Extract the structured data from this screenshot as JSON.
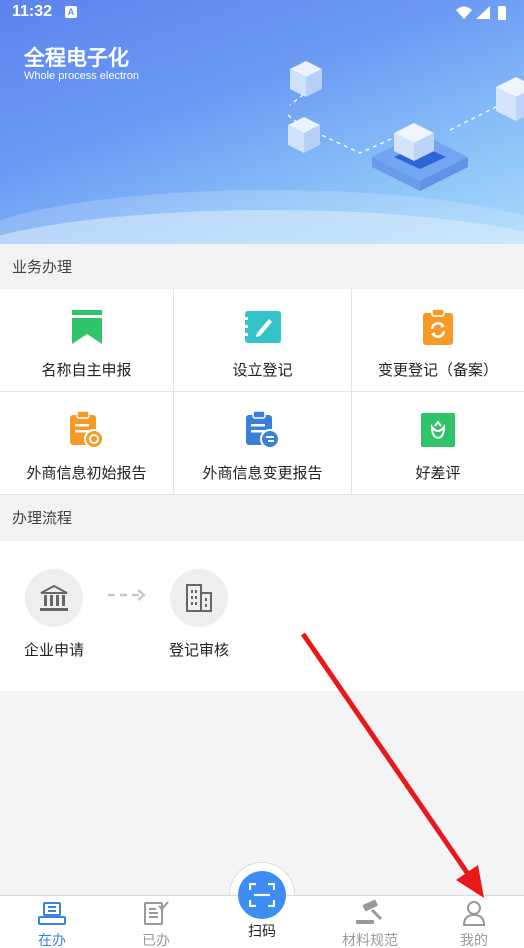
{
  "status_bar": {
    "time": "11:32",
    "notification_badge": "A"
  },
  "banner": {
    "title": "全程电子化",
    "subtitle": "Whole process electron"
  },
  "sections": {
    "business": "业务办理",
    "process": "办理流程"
  },
  "services": [
    {
      "label": "名称自主申报",
      "icon": "bookmark-icon",
      "color": "#2fc46a"
    },
    {
      "label": "设立登记",
      "icon": "edit-doc-icon",
      "color": "#33c3c8"
    },
    {
      "label": "变更登记（备案）",
      "icon": "clipboard-refresh-icon",
      "color": "#f59a26"
    },
    {
      "label": "外商信息初始报告",
      "icon": "clipboard-clock-icon",
      "color": "#f59a26"
    },
    {
      "label": "外商信息变更报告",
      "icon": "clipboard-exchange-icon",
      "color": "#3a7fd8"
    },
    {
      "label": "好差评",
      "icon": "flower-badge-icon",
      "color": "#2fc46a"
    }
  ],
  "process_steps": [
    {
      "label": "企业申请",
      "icon": "bank-building-icon"
    },
    {
      "label": "登记审核",
      "icon": "office-building-icon"
    }
  ],
  "tabbar": {
    "tabs": [
      {
        "label": "在办",
        "icon": "in-progress-icon",
        "active": true
      },
      {
        "label": "已办",
        "icon": "done-doc-icon",
        "active": false
      },
      {
        "label": "扫码",
        "icon": "scan-icon",
        "active": false
      },
      {
        "label": "材料规范",
        "icon": "gavel-icon",
        "active": false
      },
      {
        "label": "我的",
        "icon": "user-icon",
        "active": false
      }
    ]
  },
  "colors": {
    "accent": "#3b82e6",
    "annotation": "#e8191a"
  }
}
